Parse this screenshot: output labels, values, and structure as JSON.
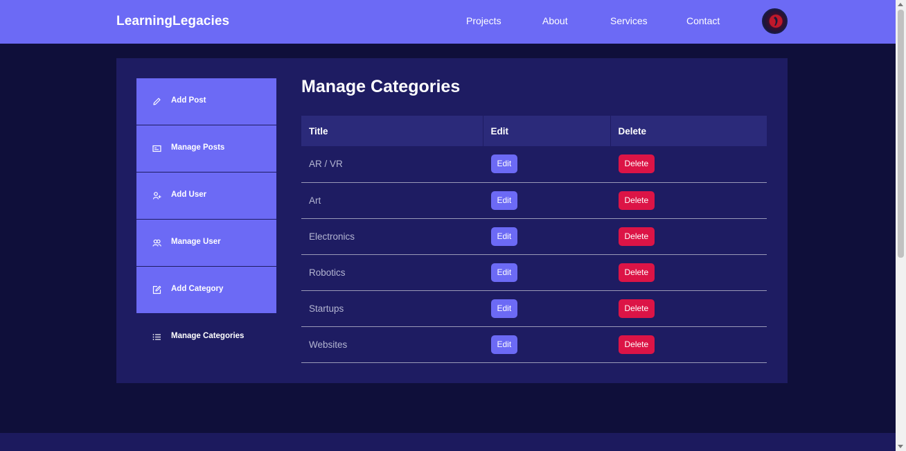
{
  "header": {
    "brand": "LearningLegacies",
    "nav": [
      "Projects",
      "About",
      "Services",
      "Contact"
    ]
  },
  "sidebar": {
    "items": [
      {
        "label": "Add Post",
        "icon": "pencil-icon"
      },
      {
        "label": "Manage Posts",
        "icon": "card-icon"
      },
      {
        "label": "Add User",
        "icon": "user-add-icon"
      },
      {
        "label": "Manage User",
        "icon": "users-icon"
      },
      {
        "label": "Add Category",
        "icon": "edit-square-icon"
      },
      {
        "label": "Manage Categories",
        "icon": "list-icon"
      }
    ]
  },
  "main": {
    "title": "Manage Categories",
    "table": {
      "headers": [
        "Title",
        "Edit",
        "Delete"
      ],
      "rows": [
        {
          "title": "AR / VR",
          "edit": "Edit",
          "delete": "Delete"
        },
        {
          "title": "Art",
          "edit": "Edit",
          "delete": "Delete"
        },
        {
          "title": "Electronics",
          "edit": "Edit",
          "delete": "Delete"
        },
        {
          "title": "Robotics",
          "edit": "Edit",
          "delete": "Delete"
        },
        {
          "title": "Startups",
          "edit": "Edit",
          "delete": "Delete"
        },
        {
          "title": "Websites",
          "edit": "Edit",
          "delete": "Delete"
        }
      ]
    }
  },
  "colors": {
    "accent": "#6c6af5",
    "danger": "#dc1446",
    "background": "#0f0f3a",
    "panel": "#1e1c62"
  }
}
